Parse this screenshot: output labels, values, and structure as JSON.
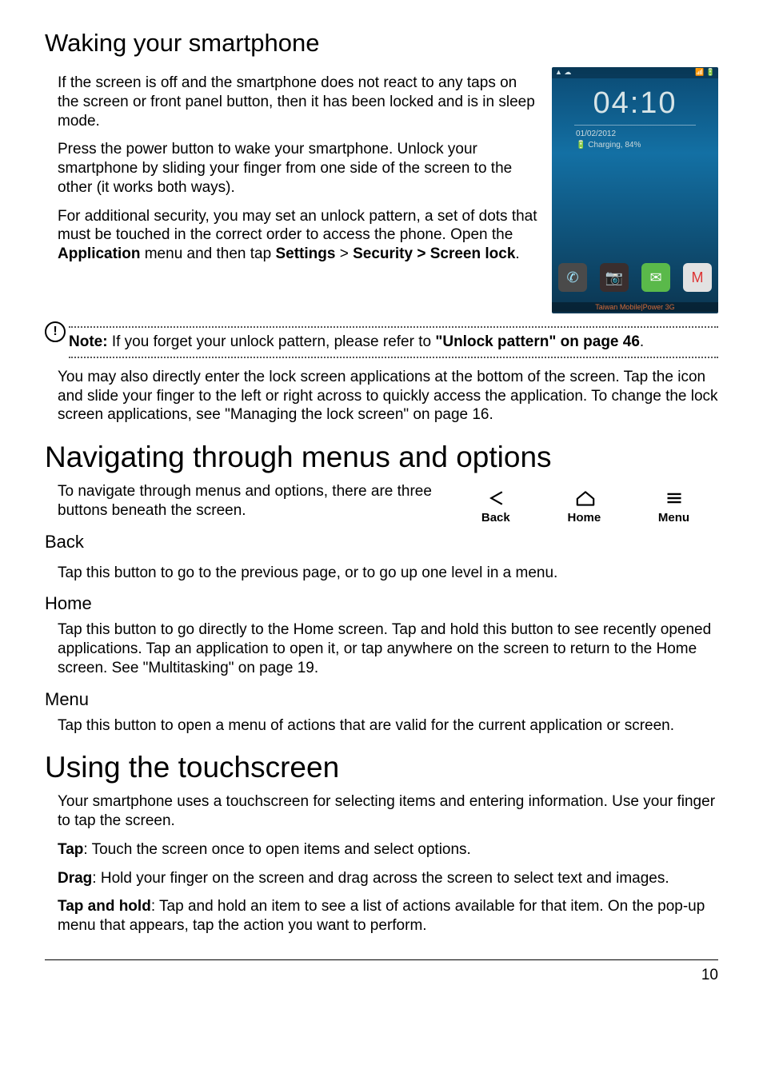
{
  "sections": {
    "waking": {
      "title": "Waking your smartphone",
      "p1": "If the screen is off and the smartphone does not react to any taps on the screen or front panel button, then it has been locked and is in sleep mode.",
      "p2": "Press the power button to wake your smartphone. Unlock your smartphone by sliding your finger from one side of the screen to the other (it works both ways).",
      "p3_a": "For additional security, you may set an unlock pattern, a set of dots that must be touched in the correct order to access the phone. Open the ",
      "p3_b_bold": "Application",
      "p3_c": " menu and then tap ",
      "p3_d_bold": "Settings",
      "p3_e": " > ",
      "p3_f_bold": "Security > Screen lock",
      "p3_g": ".",
      "note_label": "Note:",
      "note_text": " If you forget your unlock pattern, please refer to ",
      "note_link": "\"Unlock pattern\" on page 46",
      "note_end": ".",
      "p4": "You may also directly enter the lock screen applications at the bottom of the screen. Tap the icon and slide your finger to the left or right across to quickly access the application. To change the lock screen applications, see \"Managing the lock screen\" on page 16."
    },
    "nav": {
      "title": "Navigating through menus and options",
      "intro": "To navigate through menus and options, there are three buttons beneath the screen.",
      "back_h": "Back",
      "back_p": "Tap this button to go to the previous page, or to go up one level in a menu.",
      "home_h": "Home",
      "home_p": "Tap this button to go directly to the Home screen. Tap and hold this button to see recently opened applications. Tap an application to open it, or tap anywhere on the screen to return to the Home screen. See \"Multitasking\" on page 19.",
      "menu_h": "Menu",
      "menu_p": "Tap this button to open a menu of actions that are valid for the current application or screen.",
      "icons": {
        "back": "Back",
        "home": "Home",
        "menu": "Menu"
      }
    },
    "touch": {
      "title": "Using the touchscreen",
      "p1": "Your smartphone uses a touchscreen for selecting items and entering information. Use your finger to tap the screen.",
      "tap_b": "Tap",
      "tap_t": ": Touch the screen once to open items and select options.",
      "drag_b": "Drag",
      "drag_t": ": Hold your finger on the screen and drag across the screen to select text and images.",
      "th_b": "Tap and hold",
      "th_t": ": Tap and hold an item to see a list of actions available for that item. On the pop-up menu that appears, tap the action you want to perform."
    }
  },
  "phone": {
    "status_left": "▲ ☁",
    "status_right": "📶 🔋",
    "time": "04:10",
    "date": "01/02/2012",
    "charging": "🔋 Charging, 84%",
    "carrier": "Taiwan Mobile|Power 3G"
  },
  "page_number": "10"
}
